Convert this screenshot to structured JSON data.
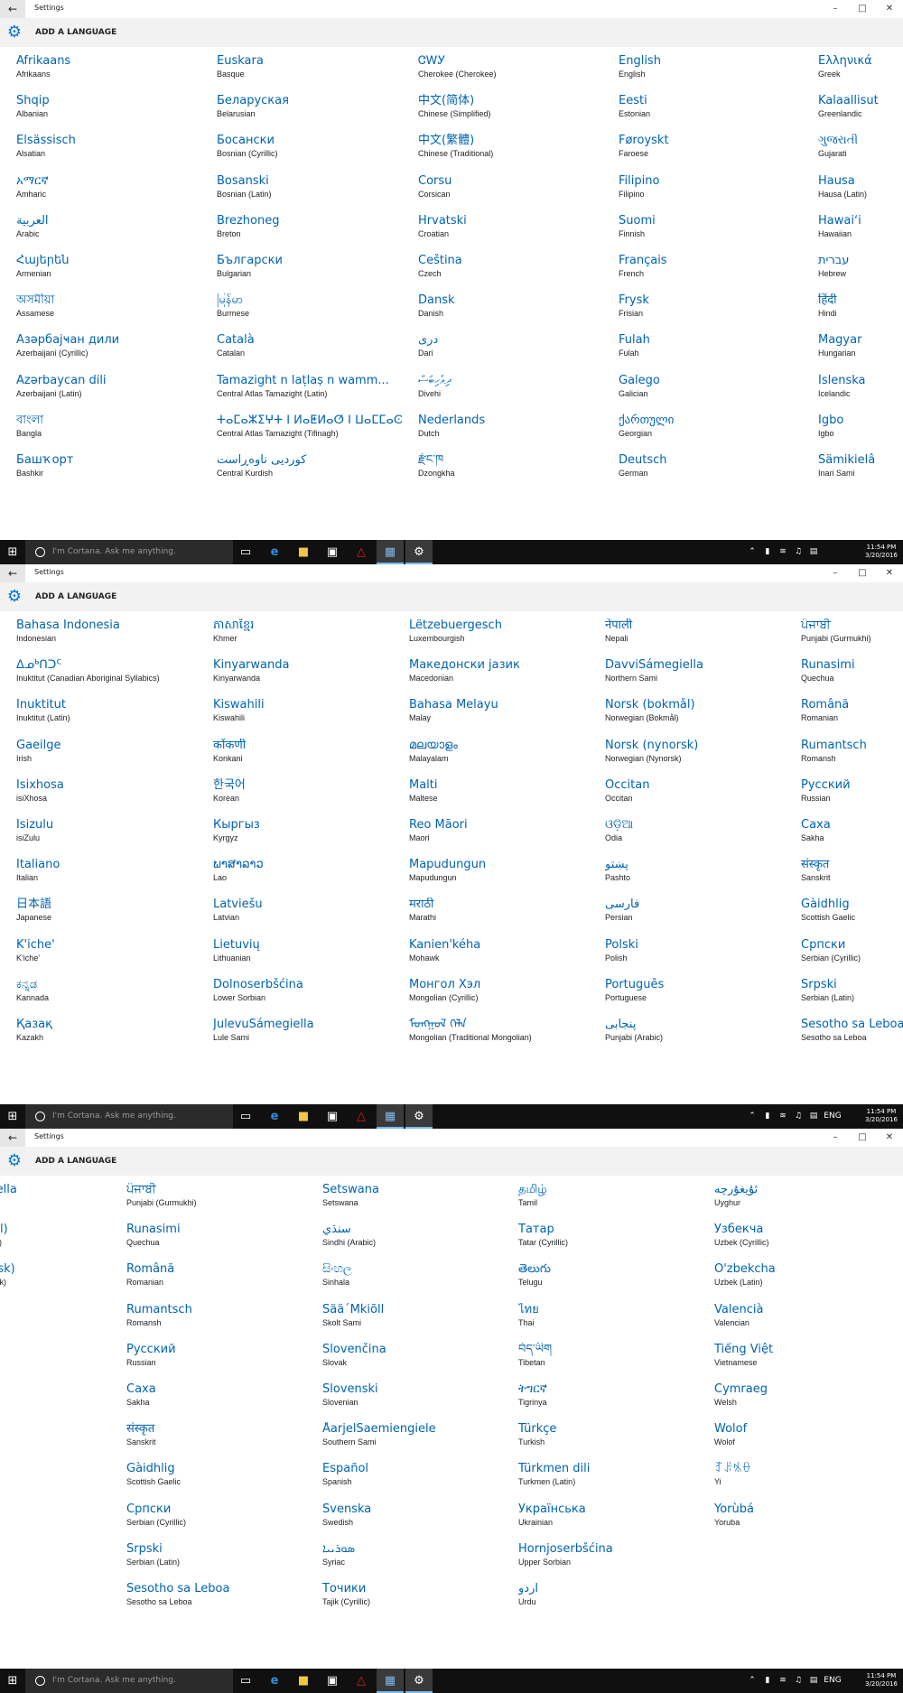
{
  "window_title": "Settings",
  "header_title": "ADD A LANGUAGE",
  "search_placeholder": "I'm Cortana. Ask me anything.",
  "clock": {
    "time": "11:54 PM",
    "date": "3/20/2016"
  },
  "tray": {
    "lang_indicator": "ENG"
  },
  "accent_color": "#0063b1",
  "screens": [
    {
      "columns": [
        [
          {
            "n": "Afrikaans",
            "s": "Afrikaans"
          },
          {
            "n": "Shqip",
            "s": "Albanian"
          },
          {
            "n": "Elsässisch",
            "s": "Alsatian"
          },
          {
            "n": "አማርኛ",
            "s": "Amharic"
          },
          {
            "n": "العربية",
            "s": "Arabic"
          },
          {
            "n": "Հայերեն",
            "s": "Armenian"
          },
          {
            "n": "অসমীয়া",
            "s": "Assamese"
          },
          {
            "n": "Азәрбајҹан дили",
            "s": "Azerbaijani (Cyrillic)"
          },
          {
            "n": "Azərbaycan dili",
            "s": "Azerbaijani (Latin)"
          },
          {
            "n": "বাংলা",
            "s": "Bangla"
          },
          {
            "n": "Башҡорт",
            "s": "Bashkir"
          }
        ],
        [
          {
            "n": "Euskara",
            "s": "Basque"
          },
          {
            "n": "Беларуская",
            "s": "Belarusian"
          },
          {
            "n": "Босански",
            "s": "Bosnian (Cyrillic)"
          },
          {
            "n": "Bosanski",
            "s": "Bosnian (Latin)"
          },
          {
            "n": "Brezhoneg",
            "s": "Breton"
          },
          {
            "n": "Български",
            "s": "Bulgarian"
          },
          {
            "n": "မြန်မာ",
            "s": "Burmese"
          },
          {
            "n": "Català",
            "s": "Catalan"
          },
          {
            "n": "Tamazight n laṭlaṣ n wamm...",
            "s": "Central Atlas Tamazight (Latin)"
          },
          {
            "n": "ⵜⴰⵎⴰⵣⵉⵖⵜ ⵏ ⵍⴰⵟⵍⴰⵚ ⵏ ⵡⴰⵎⵎⴰⵙ",
            "s": "Central Atlas Tamazight (Tifinagh)"
          },
          {
            "n": "كوردیی ناوەڕاست",
            "s": "Central Kurdish"
          }
        ],
        [
          {
            "n": "ᏣᎳᎩ",
            "s": "Cherokee (Cherokee)"
          },
          {
            "n": "中文(简体)",
            "s": "Chinese (Simplified)"
          },
          {
            "n": "中文(繁體)",
            "s": "Chinese (Traditional)"
          },
          {
            "n": "Corsu",
            "s": "Corsican"
          },
          {
            "n": "Hrvatski",
            "s": "Croatian"
          },
          {
            "n": "Čeština",
            "s": "Czech"
          },
          {
            "n": "Dansk",
            "s": "Danish"
          },
          {
            "n": "دری",
            "s": "Dari"
          },
          {
            "n": "ދިވެހިބަސް",
            "s": "Divehi"
          },
          {
            "n": "Nederlands",
            "s": "Dutch"
          },
          {
            "n": "རྫོང་ཁ",
            "s": "Dzongkha"
          }
        ],
        [
          {
            "n": "English",
            "s": "English"
          },
          {
            "n": "Eesti",
            "s": "Estonian"
          },
          {
            "n": "Føroyskt",
            "s": "Faroese"
          },
          {
            "n": "Filipino",
            "s": "Filipino"
          },
          {
            "n": "Suomi",
            "s": "Finnish"
          },
          {
            "n": "Français",
            "s": "French"
          },
          {
            "n": "Frysk",
            "s": "Frisian"
          },
          {
            "n": "Fulah",
            "s": "Fulah"
          },
          {
            "n": "Galego",
            "s": "Galician"
          },
          {
            "n": "ქართული",
            "s": "Georgian"
          },
          {
            "n": "Deutsch",
            "s": "German"
          }
        ],
        [
          {
            "n": "Ελληνικά",
            "s": "Greek"
          },
          {
            "n": "Kalaallisut",
            "s": "Greenlandic"
          },
          {
            "n": "ગુજરાતી",
            "s": "Gujarati"
          },
          {
            "n": "Hausa",
            "s": "Hausa (Latin)"
          },
          {
            "n": "Hawaiʻi",
            "s": "Hawaiian"
          },
          {
            "n": "עברית",
            "s": "Hebrew"
          },
          {
            "n": "हिंदी",
            "s": "Hindi"
          },
          {
            "n": "Magyar",
            "s": "Hungarian"
          },
          {
            "n": "Íslenska",
            "s": "Icelandic"
          },
          {
            "n": "Igbo",
            "s": "Igbo"
          },
          {
            "n": "Sämikielâ",
            "s": "Inari Sami"
          }
        ]
      ]
    },
    {
      "columns": [
        [
          {
            "n": "Bahasa Indonesia",
            "s": "Indonesian"
          },
          {
            "n": "ᐃᓄᒃᑎᑐᑦ",
            "s": "Inuktitut (Canadian Aboriginal Syllabics)"
          },
          {
            "n": "Inuktitut",
            "s": "Inuktitut (Latin)"
          },
          {
            "n": "Gaeilge",
            "s": "Irish"
          },
          {
            "n": "Isixhosa",
            "s": "isiXhosa"
          },
          {
            "n": "Isizulu",
            "s": "isiZulu"
          },
          {
            "n": "Italiano",
            "s": "Italian"
          },
          {
            "n": "日本語",
            "s": "Japanese"
          },
          {
            "n": "K'iche'",
            "s": "K'iche'"
          },
          {
            "n": "ಕನ್ನಡ",
            "s": "Kannada"
          },
          {
            "n": "Қазақ",
            "s": "Kazakh"
          }
        ],
        [
          {
            "n": "ភាសាខ្មែរ",
            "s": "Khmer"
          },
          {
            "n": "Kinyarwanda",
            "s": "Kinyarwanda"
          },
          {
            "n": "Kiswahili",
            "s": "Kiswahili"
          },
          {
            "n": "कोंकणी",
            "s": "Konkani"
          },
          {
            "n": "한국어",
            "s": "Korean"
          },
          {
            "n": "Кыргыз",
            "s": "Kyrgyz"
          },
          {
            "n": "ພາສາລາວ",
            "s": "Lao"
          },
          {
            "n": "Latviešu",
            "s": "Latvian"
          },
          {
            "n": "Lietuvių",
            "s": "Lithuanian"
          },
          {
            "n": "Dolnoserbšćina",
            "s": "Lower Sorbian"
          },
          {
            "n": "JulevuSámegiella",
            "s": "Lule Sami"
          }
        ],
        [
          {
            "n": "Lëtzebuergesch",
            "s": "Luxembourgish"
          },
          {
            "n": "Македонски јазик",
            "s": "Macedonian"
          },
          {
            "n": "Bahasa Melayu",
            "s": "Malay"
          },
          {
            "n": "മലയാളം",
            "s": "Malayalam"
          },
          {
            "n": "Malti",
            "s": "Maltese"
          },
          {
            "n": "Reo Māori",
            "s": "Maori"
          },
          {
            "n": "Mapudungun",
            "s": "Mapudungun"
          },
          {
            "n": "मराठी",
            "s": "Marathi"
          },
          {
            "n": "Kanien'kéha",
            "s": "Mohawk"
          },
          {
            "n": "Монгол Хэл",
            "s": "Mongolian (Cyrillic)"
          },
          {
            "n": "ᠮᠣᠩᠭᠣᠯ ᠬᠡᠯᠡ",
            "s": "Mongolian (Traditional Mongolian)"
          }
        ],
        [
          {
            "n": "नेपाली",
            "s": "Nepali"
          },
          {
            "n": "DavviSámegiella",
            "s": "Northern Sami"
          },
          {
            "n": "Norsk (bokmål)",
            "s": "Norwegian (Bokmål)"
          },
          {
            "n": "Norsk (nynorsk)",
            "s": "Norwegian (Nynorsk)"
          },
          {
            "n": "Occitan",
            "s": "Occitan"
          },
          {
            "n": "ଓଡ଼ିଆ",
            "s": "Odia"
          },
          {
            "n": "پښتو",
            "s": "Pashto"
          },
          {
            "n": "فارسی",
            "s": "Persian"
          },
          {
            "n": "Polski",
            "s": "Polish"
          },
          {
            "n": "Português",
            "s": "Portuguese"
          },
          {
            "n": "پنجابی",
            "s": "Punjabi (Arabic)"
          }
        ],
        [
          {
            "n": "ਪੰਜਾਬੀ",
            "s": "Punjabi (Gurmukhi)"
          },
          {
            "n": "Runasimi",
            "s": "Quechua"
          },
          {
            "n": "Română",
            "s": "Romanian"
          },
          {
            "n": "Rumantsch",
            "s": "Romansh"
          },
          {
            "n": "Русский",
            "s": "Russian"
          },
          {
            "n": "Саха",
            "s": "Sakha"
          },
          {
            "n": "संस्कृत",
            "s": "Sanskrit"
          },
          {
            "n": "Gàidhlig",
            "s": "Scottish Gaelic"
          },
          {
            "n": "Српски",
            "s": "Serbian (Cyrillic)"
          },
          {
            "n": "Srpski",
            "s": "Serbian (Latin)"
          },
          {
            "n": "Sesotho sa Leboa",
            "s": "Sesotho sa Leboa"
          }
        ]
      ]
    },
    {
      "columns": [
        [
          {
            "n": "iella",
            "s": ""
          },
          {
            "n": "ål)",
            "s": "ål)"
          },
          {
            "n": "rsk)",
            "s": "rsk)"
          }
        ],
        [
          {
            "n": "ਪੰਜਾਬੀ",
            "s": "Punjabi (Gurmukhi)"
          },
          {
            "n": "Runasimi",
            "s": "Quechua"
          },
          {
            "n": "Română",
            "s": "Romanian"
          },
          {
            "n": "Rumantsch",
            "s": "Romansh"
          },
          {
            "n": "Русский",
            "s": "Russian"
          },
          {
            "n": "Саха",
            "s": "Sakha"
          },
          {
            "n": "संस्कृत",
            "s": "Sanskrit"
          },
          {
            "n": "Gàidhlig",
            "s": "Scottish Gaelic"
          },
          {
            "n": "Српски",
            "s": "Serbian (Cyrillic)"
          },
          {
            "n": "Srpski",
            "s": "Serbian (Latin)"
          },
          {
            "n": "Sesotho sa Leboa",
            "s": "Sesotho sa Leboa"
          }
        ],
        [
          {
            "n": "Setswana",
            "s": "Setswana"
          },
          {
            "n": "سنڌي",
            "s": "Sindhi (Arabic)"
          },
          {
            "n": "සිංහල",
            "s": "Sinhala"
          },
          {
            "n": "Sää´Mǩiõll",
            "s": "Skolt Sami"
          },
          {
            "n": "Slovenčina",
            "s": "Slovak"
          },
          {
            "n": "Slovenski",
            "s": "Slovenian"
          },
          {
            "n": "ÅarjelSaemiengiele",
            "s": "Southern Sami"
          },
          {
            "n": "Español",
            "s": "Spanish"
          },
          {
            "n": "Svenska",
            "s": "Swedish"
          },
          {
            "n": "ܣܘܪܝܝܐ",
            "s": "Syriac"
          },
          {
            "n": "Точики",
            "s": "Tajik (Cyrillic)"
          }
        ],
        [
          {
            "n": "தமிழ்",
            "s": "Tamil"
          },
          {
            "n": "Татар",
            "s": "Tatar (Cyrillic)"
          },
          {
            "n": "తెలుగు",
            "s": "Telugu"
          },
          {
            "n": "ไทย",
            "s": "Thai"
          },
          {
            "n": "བོད་ཡིག",
            "s": "Tibetan"
          },
          {
            "n": "ትግርኛ",
            "s": "Tigrinya"
          },
          {
            "n": "Türkçe",
            "s": "Turkish"
          },
          {
            "n": "Türkmen dili",
            "s": "Turkmen (Latin)"
          },
          {
            "n": "Українська",
            "s": "Ukrainian"
          },
          {
            "n": "Hornjoserbšćina",
            "s": "Upper Sorbian"
          },
          {
            "n": "اردو",
            "s": "Urdu"
          }
        ],
        [
          {
            "n": "ئۇيغۇرچە",
            "s": "Uyghur"
          },
          {
            "n": "Ўзбекча",
            "s": "Uzbek (Cyrillic)"
          },
          {
            "n": "O'zbekcha",
            "s": "Uzbek (Latin)"
          },
          {
            "n": "Valencià",
            "s": "Valencian"
          },
          {
            "n": "Tiếng Việt",
            "s": "Vietnamese"
          },
          {
            "n": "Cymraeg",
            "s": "Welsh"
          },
          {
            "n": "Wolof",
            "s": "Wolof"
          },
          {
            "n": "ꆈꌠꁱꂷ",
            "s": "Yi"
          },
          {
            "n": "Yorùbá",
            "s": "Yoruba"
          }
        ]
      ]
    }
  ]
}
